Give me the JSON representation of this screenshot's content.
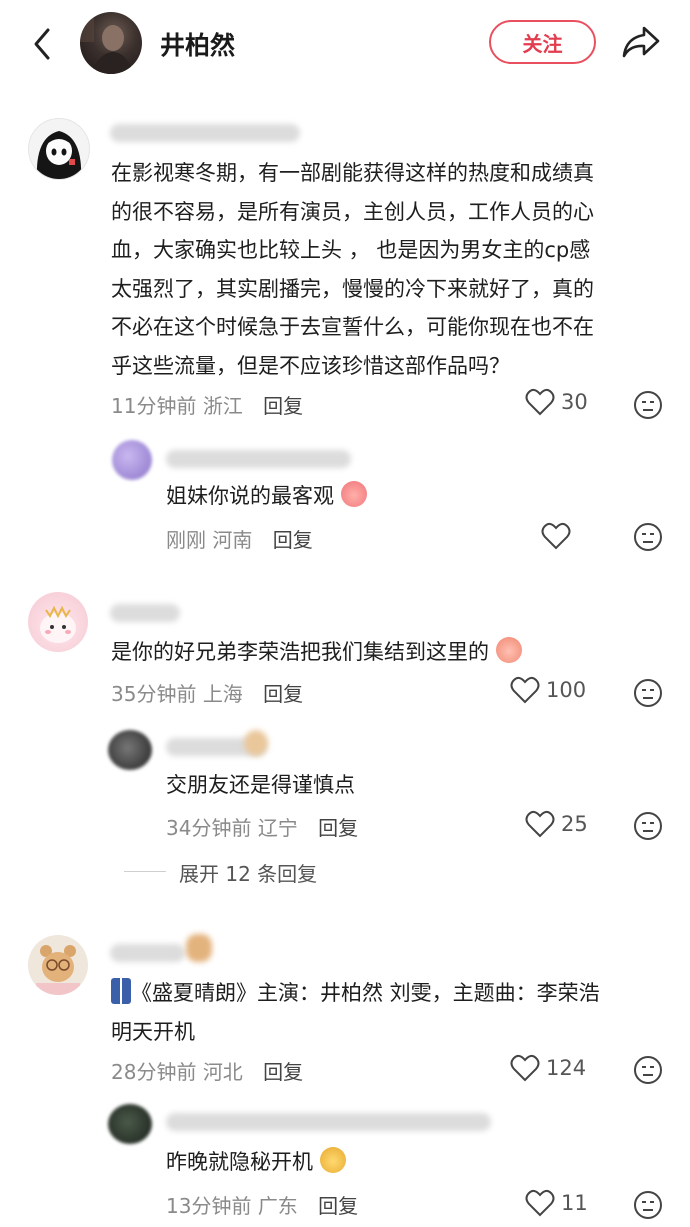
{
  "header": {
    "title": "井柏然",
    "follow_label": "关注"
  },
  "comments": [
    {
      "text_lines": [
        "在影视寒冬期，有一部剧能获得这样的热度和成绩真",
        "的很不容易，是所有演员，主创人员，工作人员的心",
        "血，大家确实也比较上头 ， 也是因为男女主的cp感",
        "太强烈了，其实剧播完，慢慢的冷下来就好了，真的",
        "不必在这个时候急于去宣誓什么，可能你现在也不在",
        "乎这些流量，但是不应该珍惜这部作品吗？"
      ],
      "time": "11分钟前",
      "location": "浙江",
      "reply_label": "回复",
      "likes": "30",
      "reply": {
        "text": "姐妹你说的最客观",
        "time": "刚刚",
        "location": "河南",
        "reply_label": "回复",
        "likes": ""
      }
    },
    {
      "text": "是你的好兄弟李荣浩把我们集结到这里的",
      "time": "35分钟前",
      "location": "上海",
      "reply_label": "回复",
      "likes": "100",
      "reply": {
        "text": "交朋友还是得谨慎点",
        "time": "34分钟前",
        "location": "辽宁",
        "reply_label": "回复",
        "likes": "25"
      },
      "expand_label": "展开 12 条回复"
    },
    {
      "text_lines": [
        "《盛夏晴朗》主演：井柏然 刘雯，主题曲：李荣浩",
        "明天开机"
      ],
      "time": "28分钟前",
      "location": "河北",
      "reply_label": "回复",
      "likes": "124",
      "reply": {
        "text": "昨晚就隐秘开机",
        "time": "13分钟前",
        "location": "广东",
        "reply_label": "回复",
        "likes": "11"
      }
    }
  ]
}
